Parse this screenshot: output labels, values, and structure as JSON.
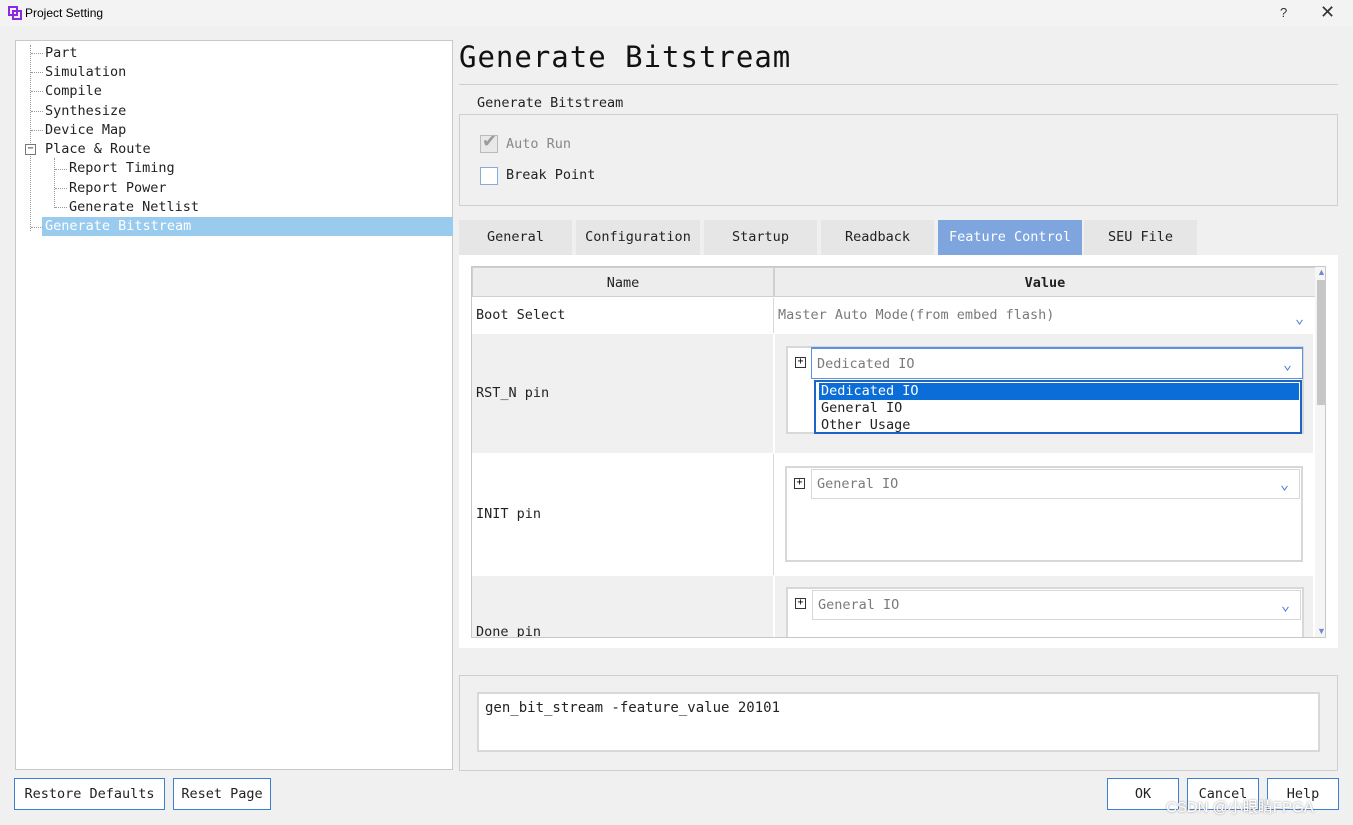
{
  "window": {
    "title": "Project Setting",
    "help_glyph": "?",
    "close_glyph": "✕"
  },
  "tree": {
    "items": [
      {
        "label": "Part"
      },
      {
        "label": "Simulation"
      },
      {
        "label": "Compile"
      },
      {
        "label": "Synthesize"
      },
      {
        "label": "Device Map"
      },
      {
        "label": "Place & Route"
      },
      {
        "label": "Report Timing"
      },
      {
        "label": "Report Power"
      },
      {
        "label": "Generate Netlist"
      },
      {
        "label": "Generate Bitstream"
      }
    ],
    "selected": "Generate Bitstream",
    "expander_glyph": "−"
  },
  "page": {
    "heading": "Generate Bitstream",
    "section_label": "Generate Bitstream",
    "auto_run_label": "Auto Run",
    "auto_run_checked": true,
    "auto_run_disabled": true,
    "break_point_label": "Break Point",
    "break_point_checked": false
  },
  "tabs": [
    {
      "label": "General"
    },
    {
      "label": "Configuration"
    },
    {
      "label": "Startup"
    },
    {
      "label": "Readback"
    },
    {
      "label": "Feature Control"
    },
    {
      "label": "SEU File"
    }
  ],
  "active_tab": "Feature Control",
  "grid": {
    "headers": {
      "name": "Name",
      "value": "Value"
    },
    "rows": [
      {
        "name": "Boot Select",
        "value": "Master Auto Mode(from embed flash)"
      },
      {
        "name": "RST_N pin",
        "value": "Dedicated IO"
      },
      {
        "name": "INIT pin",
        "value": "General IO"
      },
      {
        "name": "Done pin",
        "value": "General IO"
      }
    ],
    "dropdown_options": [
      "Dedicated IO",
      "General IO",
      "Other Usage"
    ],
    "dropdown_selected": "Dedicated IO",
    "plus_glyph": "+",
    "chevron_glyph": "⌄"
  },
  "command": {
    "text": "gen_bit_stream -feature_value 20101"
  },
  "buttons": {
    "restore_defaults": "Restore Defaults",
    "reset_page": "Reset Page",
    "ok": "OK",
    "cancel": "Cancel",
    "help": "Help"
  },
  "watermark": "CSDN @小眼睛FPGA",
  "colors": {
    "selection": "#99cbef",
    "active_tab": "#7ea5dd",
    "dropdown_highlight": "#0b6dd8",
    "button_border": "#3d7fd0"
  }
}
